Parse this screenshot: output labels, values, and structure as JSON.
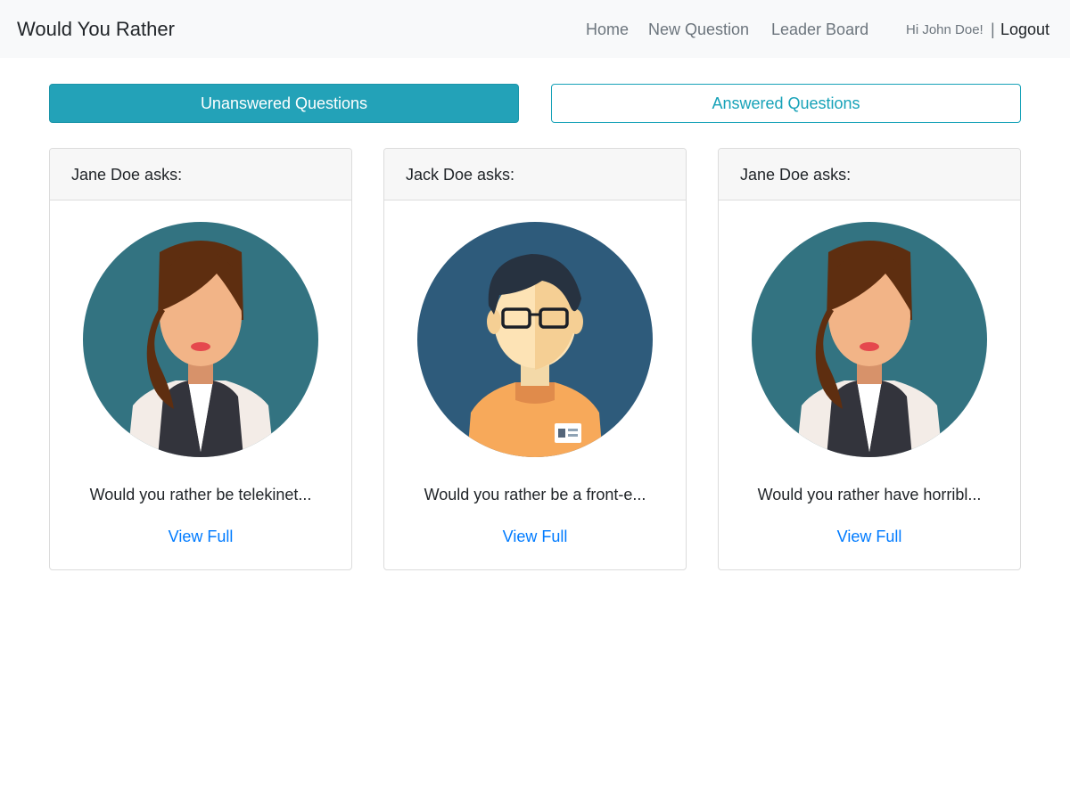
{
  "nav": {
    "brand": "Would You Rather",
    "links": [
      "Home",
      "New Question",
      "Leader Board"
    ],
    "greeting": "Hi John Doe!",
    "divider": "|",
    "logout": "Logout"
  },
  "tabs": {
    "unanswered": "Unanswered Questions",
    "answered": "Answered Questions",
    "active": "unanswered"
  },
  "questions": [
    {
      "author": "Jane Doe asks:",
      "avatar": "woman-avatar-icon",
      "preview": "Would you rather be telekinet...",
      "link": "View Full"
    },
    {
      "author": "Jack Doe asks:",
      "avatar": "man-glasses-avatar-icon",
      "preview": "Would you rather be a front-e...",
      "link": "View Full"
    },
    {
      "author": "Jane Doe asks:",
      "avatar": "woman-avatar-icon",
      "preview": "Would you rather have horribl...",
      "link": "View Full"
    }
  ],
  "colors": {
    "navbar_bg": "#f8f9fa",
    "accent": "#17a2b8",
    "link": "#007bff",
    "woman_avatar_bg": "#337381",
    "man_avatar_bg": "#2e5b7b"
  }
}
